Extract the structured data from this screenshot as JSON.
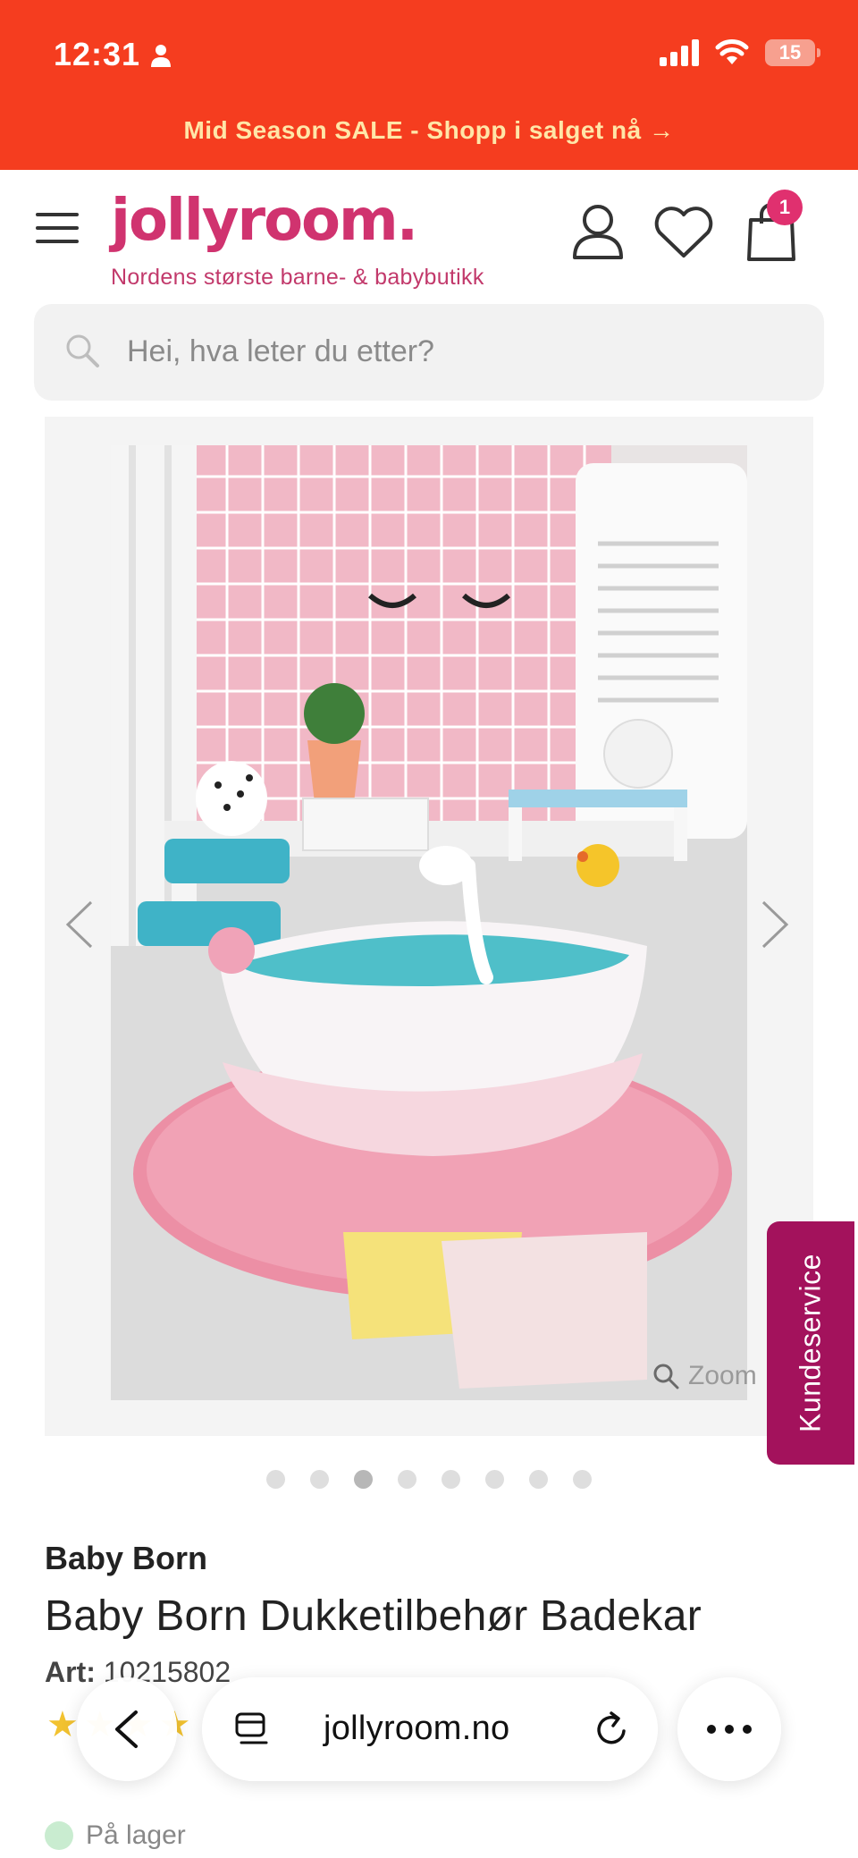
{
  "status_bar": {
    "time": "12:31",
    "battery": "15"
  },
  "promo": {
    "text": "Mid Season SALE - Shopp i salget nå →"
  },
  "header": {
    "logo": "jollyroom.",
    "tagline": "Nordens største barne- & babybutikk",
    "cart_count": "1",
    "icons": [
      "menu-icon",
      "account-icon",
      "heart-icon",
      "cart-icon"
    ]
  },
  "search": {
    "placeholder": "Hei, hva leter du etter?"
  },
  "gallery": {
    "zoom_label": "Zoom",
    "image_count": 8,
    "active_index": 2
  },
  "kundeservice": {
    "label": "Kundeservice"
  },
  "product": {
    "brand": "Baby Born",
    "title": "Baby Born Dukketilbehør Badekar",
    "art_label": "Art:",
    "art_number": "10215802",
    "stock": "På lager"
  },
  "browser": {
    "url": "jollyroom.no"
  },
  "colors": {
    "status_bar": "#f53d1f",
    "brand_pink": "#d0336f",
    "kundeservice": "#a3125c",
    "promo_text": "#ffe6a8"
  }
}
